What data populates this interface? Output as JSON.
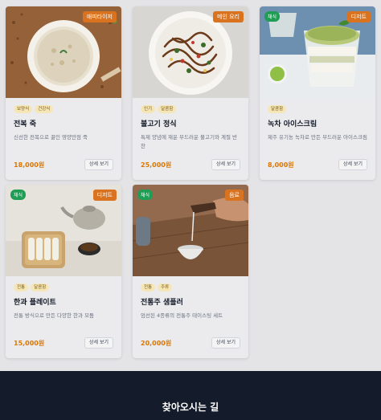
{
  "menu": {
    "items": [
      {
        "category": "애피타이저",
        "diet": "",
        "tags": [
          "보양식",
          "건강식"
        ],
        "title": "전복 죽",
        "description": "신선한 전복으로 끓인 영양만점 죽",
        "price": "18,000원",
        "button": "상세 보기"
      },
      {
        "category": "메인 요리",
        "diet": "",
        "tags": [
          "인기",
          "달콤함"
        ],
        "title": "불고기 정식",
        "description": "특제 양념에 재운 부드러운 불고기와 계절 반찬",
        "price": "25,000원",
        "button": "상세 보기"
      },
      {
        "category": "디저트",
        "diet": "채식",
        "tags": [
          "달콤함"
        ],
        "title": "녹차 아이스크림",
        "description": "제주 유기농 녹차로 만든 부드러운 아이스크림",
        "price": "8,000원",
        "button": "상세 보기"
      },
      {
        "category": "디저트",
        "diet": "채식",
        "tags": [
          "전통",
          "달콤함"
        ],
        "title": "한과 플레이트",
        "description": "전통 방식으로 만든 다양한 한과 모둠",
        "price": "15,000원",
        "button": "상세 보기"
      },
      {
        "category": "음료",
        "diet": "채식",
        "tags": [
          "전통",
          "주류"
        ],
        "title": "전통주 샘플러",
        "description": "엄선된 4종류의 전통주 테이스팅 세트",
        "price": "20,000원",
        "button": "상세 보기"
      }
    ]
  },
  "footer": {
    "title": "찾아오시는 길"
  },
  "colors": {
    "accent": "#d9731f",
    "price": "#d97706",
    "veg_badge": "#1f9d55",
    "tag_bg": "#f5e6b8",
    "footer_bg": "#141b2a"
  }
}
